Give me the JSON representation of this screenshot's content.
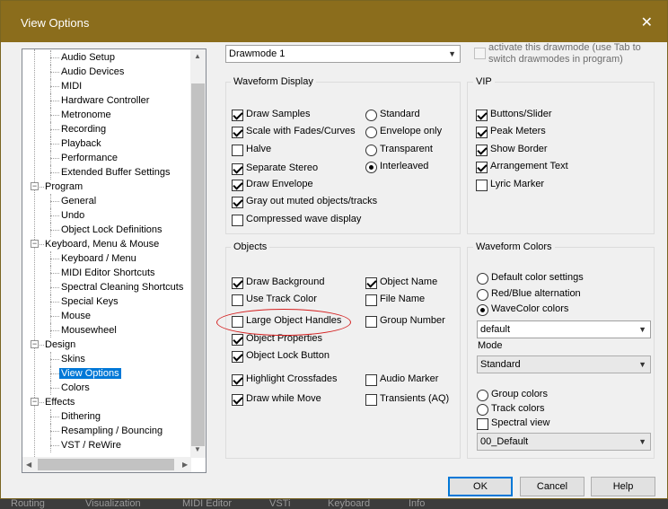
{
  "window": {
    "title": "View Options"
  },
  "tree": {
    "items": [
      {
        "label": "Audio Setup",
        "level": 2
      },
      {
        "label": "Audio Devices",
        "level": 2
      },
      {
        "label": "MIDI",
        "level": 2
      },
      {
        "label": "Hardware Controller",
        "level": 2
      },
      {
        "label": "Metronome",
        "level": 2
      },
      {
        "label": "Recording",
        "level": 2
      },
      {
        "label": "Playback",
        "level": 2
      },
      {
        "label": "Performance",
        "level": 2
      },
      {
        "label": "Extended Buffer Settings",
        "level": 2
      },
      {
        "label": "Program",
        "level": 1
      },
      {
        "label": "General",
        "level": 2
      },
      {
        "label": "Undo",
        "level": 2
      },
      {
        "label": "Object Lock Definitions",
        "level": 2
      },
      {
        "label": "Keyboard, Menu & Mouse",
        "level": 1
      },
      {
        "label": "Keyboard / Menu",
        "level": 2
      },
      {
        "label": "MIDI Editor Shortcuts",
        "level": 2
      },
      {
        "label": "Spectral Cleaning Shortcuts",
        "level": 2
      },
      {
        "label": "Special Keys",
        "level": 2
      },
      {
        "label": "Mouse",
        "level": 2
      },
      {
        "label": "Mousewheel",
        "level": 2
      },
      {
        "label": "Design",
        "level": 1
      },
      {
        "label": "Skins",
        "level": 2
      },
      {
        "label": "View Options",
        "level": 2,
        "selected": true
      },
      {
        "label": "Colors",
        "level": 2
      },
      {
        "label": "Effects",
        "level": 1
      },
      {
        "label": "Dithering",
        "level": 2
      },
      {
        "label": "Resampling / Bouncing",
        "level": 2
      },
      {
        "label": "VST / ReWire",
        "level": 2
      }
    ]
  },
  "drawmode": {
    "selected": "Drawmode 1",
    "activate_label": "activate this drawmode (use Tab to switch drawmodes in program)",
    "activate_line1": "activate this drawmode (use Tab to",
    "activate_line2": "switch drawmodes in program)"
  },
  "waveform_display": {
    "title": "Waveform Display",
    "checks": [
      {
        "label": "Draw Samples",
        "checked": true
      },
      {
        "label": "Scale with Fades/Curves",
        "checked": true
      },
      {
        "label": "Halve",
        "checked": false
      },
      {
        "label": "Separate Stereo",
        "checked": true
      },
      {
        "label": "Draw Envelope",
        "checked": true
      },
      {
        "label": "Gray out muted objects/tracks",
        "checked": true
      },
      {
        "label": "Compressed wave display",
        "checked": false
      }
    ],
    "radios": [
      {
        "label": "Standard",
        "checked": false
      },
      {
        "label": "Envelope only",
        "checked": false
      },
      {
        "label": "Transparent",
        "checked": false
      },
      {
        "label": "Interleaved",
        "checked": true
      }
    ]
  },
  "vip": {
    "title": "VIP",
    "checks": [
      {
        "label": "Buttons/Slider",
        "checked": true
      },
      {
        "label": "Peak Meters",
        "checked": true
      },
      {
        "label": "Show Border",
        "checked": true
      },
      {
        "label": "Arrangement Text",
        "checked": true
      },
      {
        "label": "Lyric Marker",
        "checked": false
      }
    ]
  },
  "objects": {
    "title": "Objects",
    "left": [
      {
        "label": "Draw Background",
        "checked": true
      },
      {
        "label": "Use Track Color",
        "checked": false
      },
      {
        "label": "Large Object Handles",
        "checked": false
      },
      {
        "label": "Object Properties",
        "checked": true
      },
      {
        "label": "Object Lock Button",
        "checked": true
      },
      {
        "label": "Highlight Crossfades",
        "checked": true
      },
      {
        "label": "Draw while Move",
        "checked": true
      }
    ],
    "right": [
      {
        "label": "Object Name",
        "checked": true
      },
      {
        "label": "File Name",
        "checked": false
      },
      {
        "label": "Group Number",
        "checked": false
      },
      {
        "label": "Audio Marker",
        "checked": false
      },
      {
        "label": "Transients (AQ)",
        "checked": false
      }
    ]
  },
  "waveform_colors": {
    "title": "Waveform Colors",
    "radios": [
      {
        "label": "Default color settings",
        "checked": false
      },
      {
        "label": "Red/Blue alternation",
        "checked": false
      },
      {
        "label": "WaveColor colors",
        "checked": true
      }
    ],
    "color_preset": "default",
    "mode_label": "Mode",
    "mode_value": "Standard",
    "radios2": [
      {
        "label": "Group colors",
        "checked": false
      },
      {
        "label": "Track colors",
        "checked": false
      }
    ],
    "spectral_label": "Spectral view",
    "spectral_checked": false,
    "spectral_preset": "00_Default"
  },
  "buttons": {
    "ok": "OK",
    "cancel": "Cancel",
    "help": "Help"
  },
  "background_tabs": [
    "Routing",
    "Visualization",
    "MIDI Editor",
    "VSTi",
    "Keyboard",
    "Info"
  ]
}
